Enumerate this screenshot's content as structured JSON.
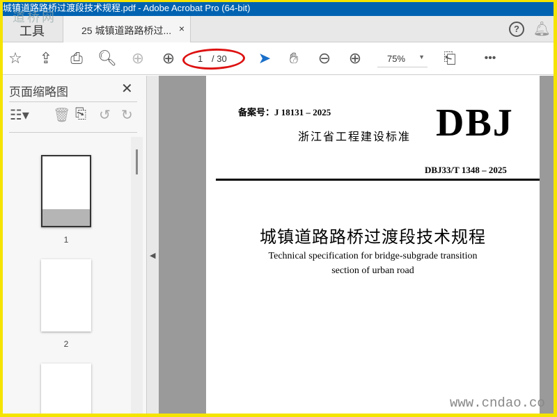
{
  "window": {
    "title": "城镇道路路桥过渡段技术规程.pdf - Adobe Acrobat Pro (64-bit)",
    "watermark": "道桥网"
  },
  "tabs": {
    "tools": "工具",
    "doc_tab": "25 城镇道路路桥过...",
    "close": "×",
    "help": "?"
  },
  "toolbar": {
    "page_current": "1",
    "page_total": "/ 30",
    "zoom": "75%"
  },
  "sidebar": {
    "title": "页面缩略图",
    "close": "✕",
    "thumbnails": [
      {
        "label": "1"
      },
      {
        "label": "2"
      },
      {
        "label": ""
      }
    ]
  },
  "document": {
    "record_no": "备案号：J 18131 – 2025",
    "province": "浙江省工程建设标准",
    "logo": "DBJ",
    "code": "DBJ33/T 1348 – 2025",
    "title_cn": "城镇道路路桥过渡段技术规程",
    "title_en_1": "Technical specification for bridge-subgrade transition",
    "title_en_2": "section of urban road"
  },
  "overlay": {
    "site": "www.cndao.co"
  },
  "colors": {
    "titlebar": "#0063b1",
    "annotation": "#dd1111",
    "frame": "#f5e400"
  }
}
